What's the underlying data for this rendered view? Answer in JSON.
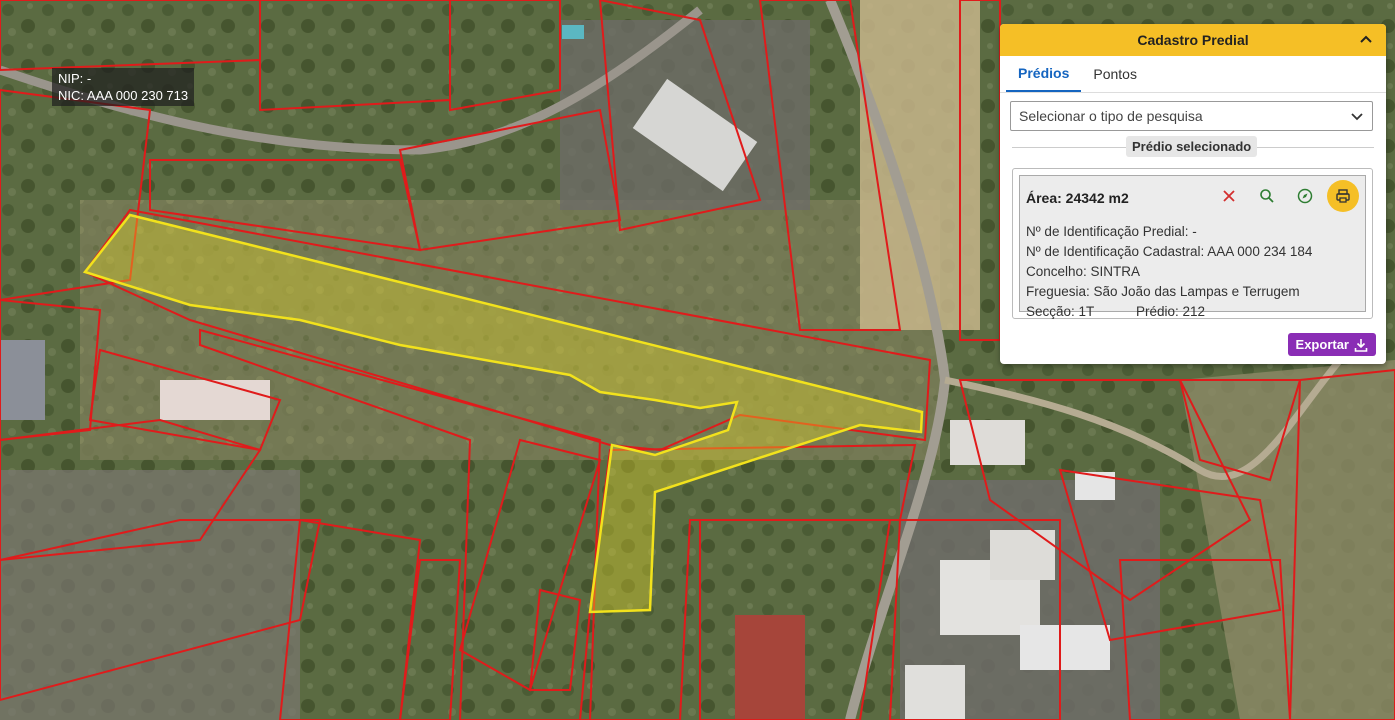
{
  "map": {
    "nip_label": "NIP: -",
    "nic_label": "NIC: AAA 000 230 713"
  },
  "panel": {
    "title": "Cadastro Predial",
    "tabs": [
      {
        "label": "Prédios",
        "active": true
      },
      {
        "label": "Pontos",
        "active": false
      }
    ],
    "search_select": "Selecionar o tipo de pesquisa",
    "section_label": "Prédio selecionado",
    "card": {
      "area": "Área: 24342 m2",
      "id_predial": "Nº de Identificação Predial: -",
      "id_cadastral": "Nº de Identificação Cadastral: AAA 000 234 184",
      "concelho": "Concelho: SINTRA",
      "freguesia": "Freguesia: São João das Lampas e Terrugem",
      "seccao": "Secção: 1T",
      "predio": "Prédio: 212"
    },
    "export_label": "Exportar"
  },
  "colors": {
    "header": "#f5bf26",
    "tab_active": "#1565c0",
    "parcel_border": "#e01b1b",
    "selected_parcel": "#f2e21c",
    "export": "#8a2db5",
    "close_icon": "#d32f2f",
    "search_icon": "#2e7d32"
  },
  "icons": [
    "chevron-up-icon",
    "chevron-down-icon",
    "close-icon",
    "search-icon",
    "compass-icon",
    "print-icon",
    "download-icon"
  ]
}
